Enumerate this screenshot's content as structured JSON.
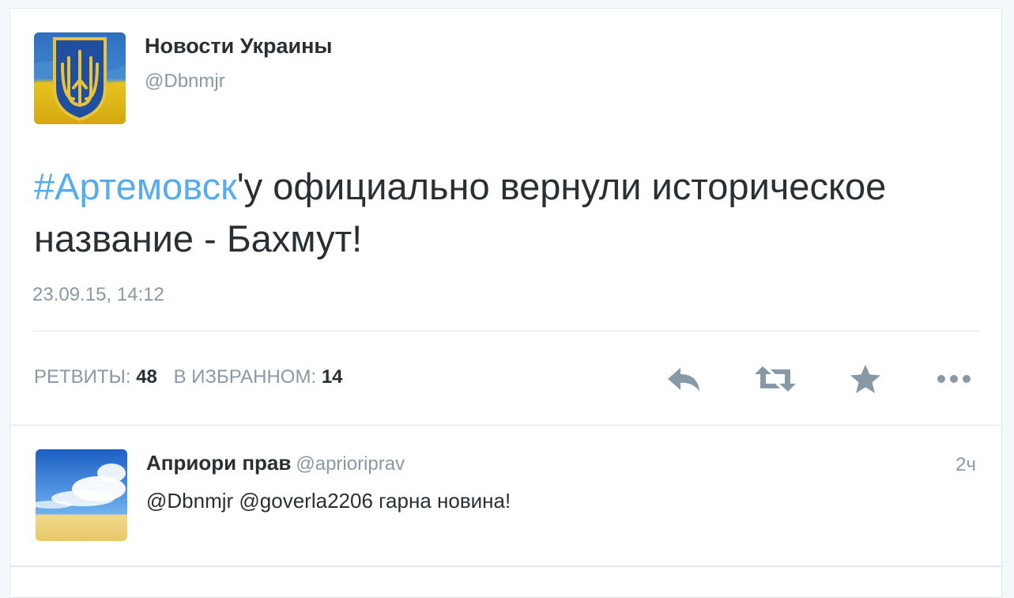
{
  "tweet": {
    "author_name": "Новости Украины",
    "author_handle": "@Dbnmjr",
    "avatar_icon": "ukraine-coat-of-arms-avatar",
    "hashtag": "#Артемовск",
    "text_rest": "'у официально вернули историческое название - Бахмут!",
    "timestamp": "23.09.15, 14:12",
    "stats": {
      "retweets_label": "РЕТВИТЫ:",
      "retweets_count": "48",
      "favorites_label": "В ИЗБРАННОМ:",
      "favorites_count": "14"
    },
    "actions": [
      "reply-icon",
      "retweet-icon",
      "favorite-star-icon",
      "more-dots-icon"
    ]
  },
  "reply": {
    "author_name": "Априори прав",
    "author_handle": "@aprioriprav",
    "time": "2ч",
    "text": "@Dbnmjr @goverla2206 гарна новина!",
    "avatar_icon": "sky-landscape-avatar"
  },
  "colors": {
    "accent": "#55acee",
    "text": "#292f33",
    "muted": "#8899a6",
    "icon": "#8899a6",
    "border": "#e1e8ed"
  }
}
